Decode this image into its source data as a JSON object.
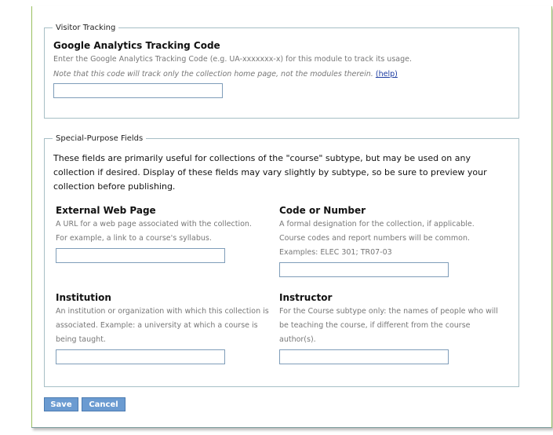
{
  "visitor_tracking": {
    "legend": "Visitor Tracking",
    "heading": "Google Analytics Tracking Code",
    "description": "Enter the Google Analytics Tracking Code (e.g. UA-xxxxxxx-x) for this module to track its usage.",
    "note": "Note that this code will track only the collection home page, not the modules therein.",
    "help_link": "(help)",
    "input_value": ""
  },
  "special_fields": {
    "legend": "Special-Purpose Fields",
    "intro": "These fields are primarily useful for collections of the \"course\" subtype, but may be used on any collection if desired. Display of these fields may vary slightly by subtype, so be sure to preview your collection before publishing.",
    "external_web_page": {
      "heading": "External Web Page",
      "description": "A URL for a web page associated with the collection. For example, a link to a course's syllabus.",
      "input_value": ""
    },
    "code_or_number": {
      "heading": "Code or Number",
      "description": "A formal designation for the collection, if applicable. Course codes and report numbers will be common. Examples: ELEC 301; TR07-03",
      "input_value": ""
    },
    "institution": {
      "heading": "Institution",
      "description": "An institution or organization with which this collection is associated. Example: a university at which a course is being taught.",
      "input_value": ""
    },
    "instructor": {
      "heading": "Instructor",
      "description": "For the Course subtype only: the names of people who will be teaching the course, if different from the course author(s).",
      "input_value": ""
    }
  },
  "buttons": {
    "save": "Save",
    "cancel": "Cancel"
  }
}
